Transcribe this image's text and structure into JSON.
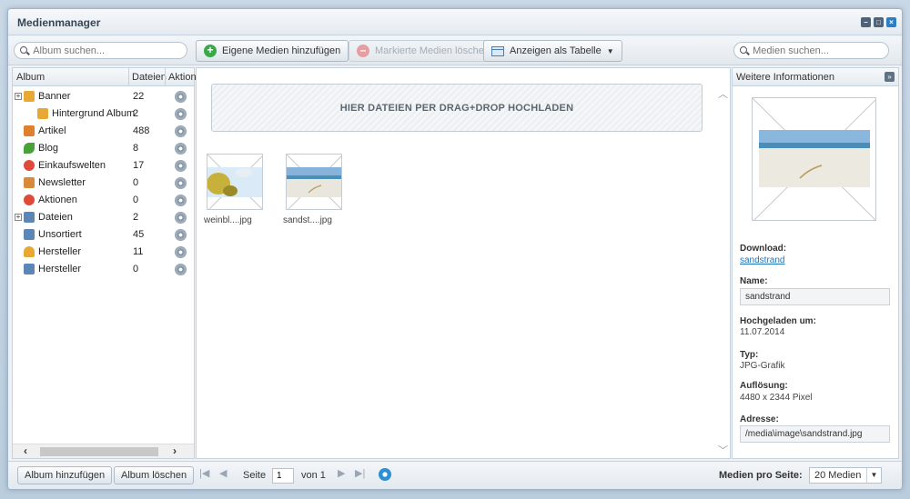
{
  "window": {
    "title": "Medienmanager"
  },
  "toolbar": {
    "album_search_placeholder": "Album suchen...",
    "add_media_label": "Eigene Medien hinzufügen",
    "delete_marked_label": "Markierte Medien löschen",
    "view_as_table_label": "Anzeigen als Tabelle",
    "media_search_placeholder": "Medien suchen..."
  },
  "album_grid": {
    "headers": {
      "album": "Album",
      "files": "Dateien",
      "actions": "Aktion"
    },
    "rows": [
      {
        "name": "Banner",
        "count": "22",
        "icon": "folder-icon",
        "color": "#e8a834"
      },
      {
        "name": "Hintergrund Album",
        "count": "2",
        "icon": "folder-icon",
        "color": "#e8a834"
      },
      {
        "name": "Artikel",
        "count": "488",
        "icon": "envelope-icon",
        "color": "#e07f2c"
      },
      {
        "name": "Blog",
        "count": "8",
        "icon": "leaf-icon",
        "color": "#4aa13a"
      },
      {
        "name": "Einkaufswelten",
        "count": "17",
        "icon": "target-icon",
        "color": "#e04a3a"
      },
      {
        "name": "Newsletter",
        "count": "0",
        "icon": "newsletter-icon",
        "color": "#d88a3a"
      },
      {
        "name": "Aktionen",
        "count": "0",
        "icon": "target-icon",
        "color": "#e04a3a"
      },
      {
        "name": "Dateien",
        "count": "2",
        "icon": "file-icon",
        "color": "#5b86b5"
      },
      {
        "name": "Unsortiert",
        "count": "45",
        "icon": "file-icon",
        "color": "#5b86b5"
      },
      {
        "name": "Hersteller",
        "count": "11",
        "icon": "car-icon",
        "color": "#e8a834"
      },
      {
        "name": "Hersteller",
        "count": "0",
        "icon": "file-icon",
        "color": "#5b86b5"
      }
    ]
  },
  "media": {
    "dropzone_label": "HIER DATEIEN PER DRAG+DROP HOCHLADEN",
    "items": [
      {
        "label": "weinbl....jpg"
      },
      {
        "label": "sandst....jpg"
      }
    ]
  },
  "info": {
    "header": "Weitere Informationen",
    "download_label": "Download:",
    "download_link": "sandstrand",
    "name_label": "Name:",
    "name_value": "sandstrand",
    "uploaded_label": "Hochgeladen um:",
    "uploaded_value": "11.07.2014",
    "type_label": "Typ:",
    "type_value": "JPG-Grafik",
    "resolution_label": "Auflösung:",
    "resolution_value": "4480 x 2344 Pixel",
    "address_label": "Adresse:",
    "address_value": "/media\\image\\sandstrand.jpg"
  },
  "bottom": {
    "add_album_label": "Album hinzufügen",
    "delete_album_label": "Album löschen",
    "page_label": "Seite",
    "page_value": "1",
    "of_label": "von 1",
    "per_page_label": "Medien pro Seite:",
    "per_page_value": "20 Medien"
  },
  "colors": {
    "accent": "#2b7fc4",
    "add_green": "#3aa94a"
  }
}
